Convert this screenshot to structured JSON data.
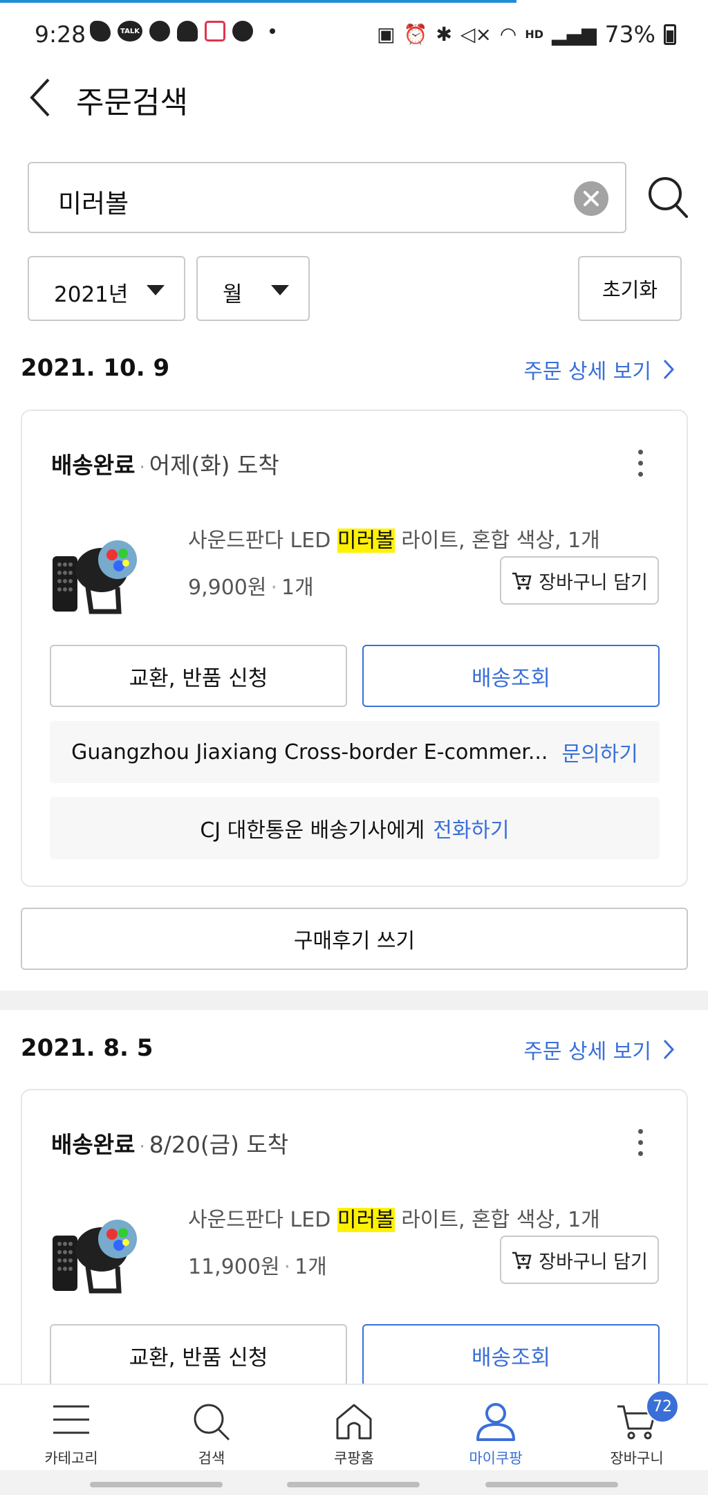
{
  "status_bar": {
    "time": "9:28",
    "battery": "73%",
    "hd_label": "HD",
    "talk_label": "TALK"
  },
  "header": {
    "title": "주문검색"
  },
  "search": {
    "value": "미러볼"
  },
  "filters": {
    "year": "2021년",
    "month": "월",
    "reset": "초기화"
  },
  "orders": [
    {
      "date": "2021. 10. 9",
      "detail_link": "주문 상세 보기",
      "status": "배송완료",
      "arrival": "어제(화) 도착",
      "product_name_pre": "사운드판다 LED ",
      "product_name_hl": "미러볼",
      "product_name_post": " 라이트, 혼합 색상, 1개",
      "price": "9,900원",
      "qty": "1개",
      "cart_add": "장바구니 담기",
      "exchange": "교환, 반품 신청",
      "track": "배송조회",
      "seller": "Guangzhou Jiaxiang Cross-border E-commer...",
      "seller_link": "문의하기",
      "courier": "CJ 대한통운 배송기사에게",
      "courier_link": "전화하기",
      "review": "구매후기 쓰기"
    },
    {
      "date": "2021. 8. 5",
      "detail_link": "주문 상세 보기",
      "status": "배송완료",
      "arrival": "8/20(금) 도착",
      "product_name_pre": "사운드판다 LED ",
      "product_name_hl": "미러볼",
      "product_name_post": " 라이트, 혼합 색상, 1개",
      "price": "11,900원",
      "qty": "1개",
      "cart_add": "장바구니 담기",
      "exchange": "교환, 반품 신청",
      "track": "배송조회"
    }
  ],
  "bottom_nav": {
    "items": [
      {
        "label": "카테고리",
        "icon": "menu-icon"
      },
      {
        "label": "검색",
        "icon": "search-icon"
      },
      {
        "label": "쿠팡홈",
        "icon": "home-icon"
      },
      {
        "label": "마이쿠팡",
        "icon": "user-icon"
      },
      {
        "label": "장바구니",
        "icon": "cart-icon"
      }
    ],
    "active_index": 3,
    "cart_badge": "72"
  },
  "colors": {
    "accent_blue": "#3a6fd8",
    "highlight_yellow": "#fff200",
    "progress_blue": "#1f8ed4"
  }
}
